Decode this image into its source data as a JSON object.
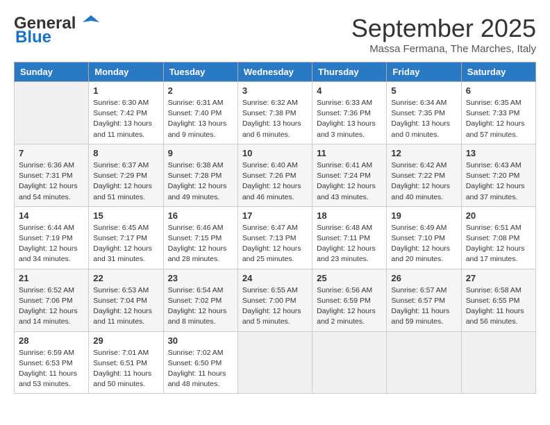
{
  "header": {
    "logo_line1": "General",
    "logo_line2": "Blue",
    "month": "September 2025",
    "location": "Massa Fermana, The Marches, Italy"
  },
  "days_of_week": [
    "Sunday",
    "Monday",
    "Tuesday",
    "Wednesday",
    "Thursday",
    "Friday",
    "Saturday"
  ],
  "weeks": [
    [
      {
        "day": "",
        "info": ""
      },
      {
        "day": "1",
        "info": "Sunrise: 6:30 AM\nSunset: 7:42 PM\nDaylight: 13 hours\nand 11 minutes."
      },
      {
        "day": "2",
        "info": "Sunrise: 6:31 AM\nSunset: 7:40 PM\nDaylight: 13 hours\nand 9 minutes."
      },
      {
        "day": "3",
        "info": "Sunrise: 6:32 AM\nSunset: 7:38 PM\nDaylight: 13 hours\nand 6 minutes."
      },
      {
        "day": "4",
        "info": "Sunrise: 6:33 AM\nSunset: 7:36 PM\nDaylight: 13 hours\nand 3 minutes."
      },
      {
        "day": "5",
        "info": "Sunrise: 6:34 AM\nSunset: 7:35 PM\nDaylight: 13 hours\nand 0 minutes."
      },
      {
        "day": "6",
        "info": "Sunrise: 6:35 AM\nSunset: 7:33 PM\nDaylight: 12 hours\nand 57 minutes."
      }
    ],
    [
      {
        "day": "7",
        "info": "Sunrise: 6:36 AM\nSunset: 7:31 PM\nDaylight: 12 hours\nand 54 minutes."
      },
      {
        "day": "8",
        "info": "Sunrise: 6:37 AM\nSunset: 7:29 PM\nDaylight: 12 hours\nand 51 minutes."
      },
      {
        "day": "9",
        "info": "Sunrise: 6:38 AM\nSunset: 7:28 PM\nDaylight: 12 hours\nand 49 minutes."
      },
      {
        "day": "10",
        "info": "Sunrise: 6:40 AM\nSunset: 7:26 PM\nDaylight: 12 hours\nand 46 minutes."
      },
      {
        "day": "11",
        "info": "Sunrise: 6:41 AM\nSunset: 7:24 PM\nDaylight: 12 hours\nand 43 minutes."
      },
      {
        "day": "12",
        "info": "Sunrise: 6:42 AM\nSunset: 7:22 PM\nDaylight: 12 hours\nand 40 minutes."
      },
      {
        "day": "13",
        "info": "Sunrise: 6:43 AM\nSunset: 7:20 PM\nDaylight: 12 hours\nand 37 minutes."
      }
    ],
    [
      {
        "day": "14",
        "info": "Sunrise: 6:44 AM\nSunset: 7:19 PM\nDaylight: 12 hours\nand 34 minutes."
      },
      {
        "day": "15",
        "info": "Sunrise: 6:45 AM\nSunset: 7:17 PM\nDaylight: 12 hours\nand 31 minutes."
      },
      {
        "day": "16",
        "info": "Sunrise: 6:46 AM\nSunset: 7:15 PM\nDaylight: 12 hours\nand 28 minutes."
      },
      {
        "day": "17",
        "info": "Sunrise: 6:47 AM\nSunset: 7:13 PM\nDaylight: 12 hours\nand 25 minutes."
      },
      {
        "day": "18",
        "info": "Sunrise: 6:48 AM\nSunset: 7:11 PM\nDaylight: 12 hours\nand 23 minutes."
      },
      {
        "day": "19",
        "info": "Sunrise: 6:49 AM\nSunset: 7:10 PM\nDaylight: 12 hours\nand 20 minutes."
      },
      {
        "day": "20",
        "info": "Sunrise: 6:51 AM\nSunset: 7:08 PM\nDaylight: 12 hours\nand 17 minutes."
      }
    ],
    [
      {
        "day": "21",
        "info": "Sunrise: 6:52 AM\nSunset: 7:06 PM\nDaylight: 12 hours\nand 14 minutes."
      },
      {
        "day": "22",
        "info": "Sunrise: 6:53 AM\nSunset: 7:04 PM\nDaylight: 12 hours\nand 11 minutes."
      },
      {
        "day": "23",
        "info": "Sunrise: 6:54 AM\nSunset: 7:02 PM\nDaylight: 12 hours\nand 8 minutes."
      },
      {
        "day": "24",
        "info": "Sunrise: 6:55 AM\nSunset: 7:00 PM\nDaylight: 12 hours\nand 5 minutes."
      },
      {
        "day": "25",
        "info": "Sunrise: 6:56 AM\nSunset: 6:59 PM\nDaylight: 12 hours\nand 2 minutes."
      },
      {
        "day": "26",
        "info": "Sunrise: 6:57 AM\nSunset: 6:57 PM\nDaylight: 11 hours\nand 59 minutes."
      },
      {
        "day": "27",
        "info": "Sunrise: 6:58 AM\nSunset: 6:55 PM\nDaylight: 11 hours\nand 56 minutes."
      }
    ],
    [
      {
        "day": "28",
        "info": "Sunrise: 6:59 AM\nSunset: 6:53 PM\nDaylight: 11 hours\nand 53 minutes."
      },
      {
        "day": "29",
        "info": "Sunrise: 7:01 AM\nSunset: 6:51 PM\nDaylight: 11 hours\nand 50 minutes."
      },
      {
        "day": "30",
        "info": "Sunrise: 7:02 AM\nSunset: 6:50 PM\nDaylight: 11 hours\nand 48 minutes."
      },
      {
        "day": "",
        "info": ""
      },
      {
        "day": "",
        "info": ""
      },
      {
        "day": "",
        "info": ""
      },
      {
        "day": "",
        "info": ""
      }
    ]
  ]
}
